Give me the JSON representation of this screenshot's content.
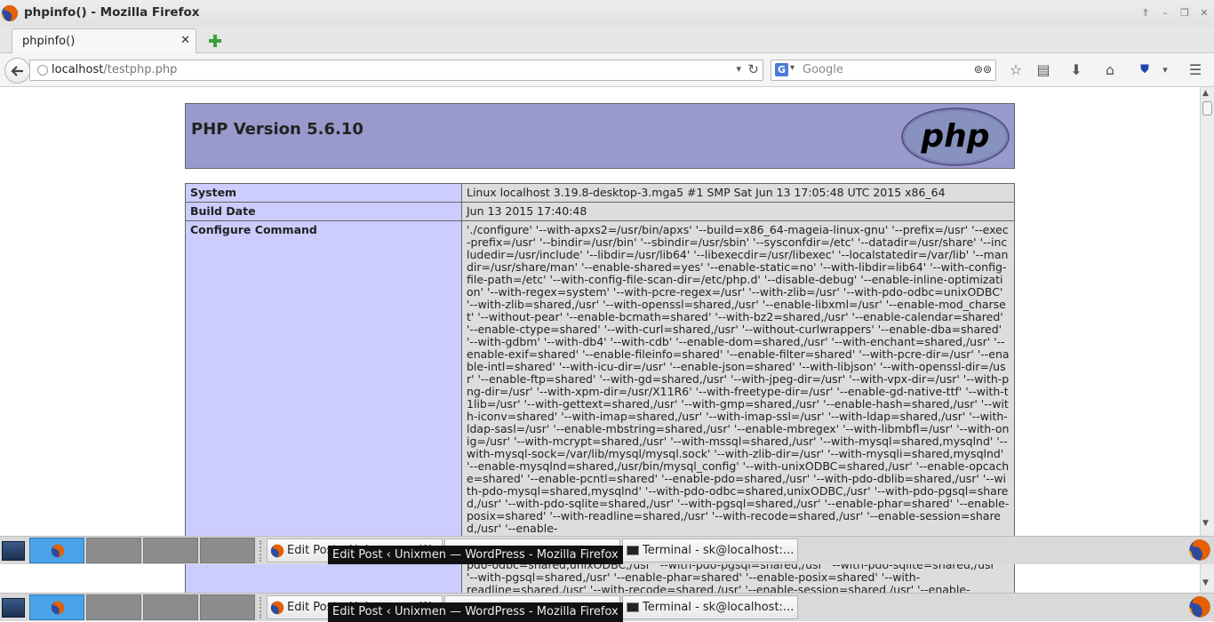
{
  "window": {
    "title": "phpinfo() - Mozilla Firefox"
  },
  "tabs": [
    {
      "label": "phpinfo()"
    }
  ],
  "navbar": {
    "url_host": "localhost",
    "url_path": "/testphp.php",
    "search_placeholder": "Google",
    "search_engine": "G"
  },
  "page": {
    "php_version": "PHP Version 5.6.10",
    "logo_text": "php",
    "rows": [
      {
        "key": "System",
        "value": "Linux localhost 3.19.8-desktop-3.mga5 #1 SMP Sat Jun 13 17:05:48 UTC 2015 x86_64"
      },
      {
        "key": "Build Date",
        "value": "Jun 13 2015 17:40:48"
      },
      {
        "key": "Configure Command",
        "value": "'./configure' '--with-apxs2=/usr/bin/apxs' '--build=x86_64-mageia-linux-gnu' '--prefix=/usr' '--exec-prefix=/usr' '--bindir=/usr/bin' '--sbindir=/usr/sbin' '--sysconfdir=/etc' '--datadir=/usr/share' '--includedir=/usr/include' '--libdir=/usr/lib64' '--libexecdir=/usr/libexec' '--localstatedir=/var/lib' '--mandir=/usr/share/man' '--enable-shared=yes' '--enable-static=no' '--with-libdir=lib64' '--with-config-file-path=/etc' '--with-config-file-scan-dir=/etc/php.d' '--disable-debug' '--enable-inline-optimization' '--with-regex=system' '--with-pcre-regex=/usr' '--with-zlib=/usr' '--with-pdo-odbc=unixODBC' '--with-zlib=shared,/usr' '--with-openssl=shared,/usr' '--enable-libxml=/usr' '--enable-mod_charset' '--without-pear' '--enable-bcmath=shared' '--with-bz2=shared,/usr' '--enable-calendar=shared' '--enable-ctype=shared' '--with-curl=shared,/usr' '--without-curlwrappers' '--enable-dba=shared' '--with-gdbm' '--with-db4' '--with-cdb' '--enable-dom=shared,/usr' '--with-enchant=shared,/usr' '--enable-exif=shared' '--enable-fileinfo=shared' '--enable-filter=shared' '--with-pcre-dir=/usr' '--enable-intl=shared' '--with-icu-dir=/usr' '--enable-json=shared' '--with-libjson' '--with-openssl-dir=/usr' '--enable-ftp=shared' '--with-gd=shared,/usr' '--with-jpeg-dir=/usr' '--with-vpx-dir=/usr' '--with-png-dir=/usr' '--with-xpm-dir=/usr/X11R6' '--with-freetype-dir=/usr' '--enable-gd-native-ttf' '--with-t1lib=/usr' '--with-gettext=shared,/usr' '--with-gmp=shared,/usr' '--enable-hash=shared,/usr' '--with-iconv=shared' '--with-imap=shared,/usr' '--with-imap-ssl=/usr' '--with-ldap=shared,/usr' '--with-ldap-sasl=/usr' '--enable-mbstring=shared,/usr' '--enable-mbregex' '--with-libmbfl=/usr' '--with-onig=/usr' '--with-mcrypt=shared,/usr' '--with-mssql=shared,/usr' '--with-mysql=shared,mysqlnd' '--with-mysql-sock=/var/lib/mysql/mysql.sock' '--with-zlib-dir=/usr' '--with-mysqli=shared,mysqlnd' '--enable-mysqlnd=shared,/usr/bin/mysql_config' '--with-unixODBC=shared,/usr' '--enable-opcache=shared' '--enable-pcntl=shared' '--enable-pdo=shared,/usr' '--with-pdo-dblib=shared,/usr' '--with-pdo-mysql=shared,mysqlnd' '--with-pdo-odbc=shared,unixODBC,/usr' '--with-pdo-pgsql=shared,/usr' '--with-pdo-sqlite=shared,/usr' '--with-pgsql=shared,/usr' '--enable-phar=shared' '--enable-posix=shared' '--with-readline=shared,/usr' '--with-recode=shared,/usr' '--enable-session=shared,/usr' '--enable-"
      }
    ]
  },
  "taskbar": {
    "tasks": [
      {
        "label": "Edit Post ‹ Unixmen — WordPress - Mozilla Firefox"
      },
      {
        "label": ""
      },
      {
        "label": "Terminal - sk@localhost:..."
      }
    ],
    "tooltip": "Edit Post ‹ Unixmen — WordPress - Mozilla Firefox"
  },
  "ghost": {
    "lines": [
      "pdo-odbc=shared,unixODBC,/usr' '--with-pdo-pgsql=shared,/usr' '--with-pdo-sqlite=shared,/usr'",
      "'--with-pgsql=shared,/usr' '--enable-phar=shared' '--enable-posix=shared' '--with-",
      "readline=shared,/usr' '--with-recode=shared,/usr' '--enable-session=shared,/usr' '--enable-"
    ]
  },
  "colors": {
    "php_header": "#9999cc",
    "table_key": "#ccccff",
    "table_value": "#dddddd",
    "active_workspace": "#4aa3e6"
  }
}
